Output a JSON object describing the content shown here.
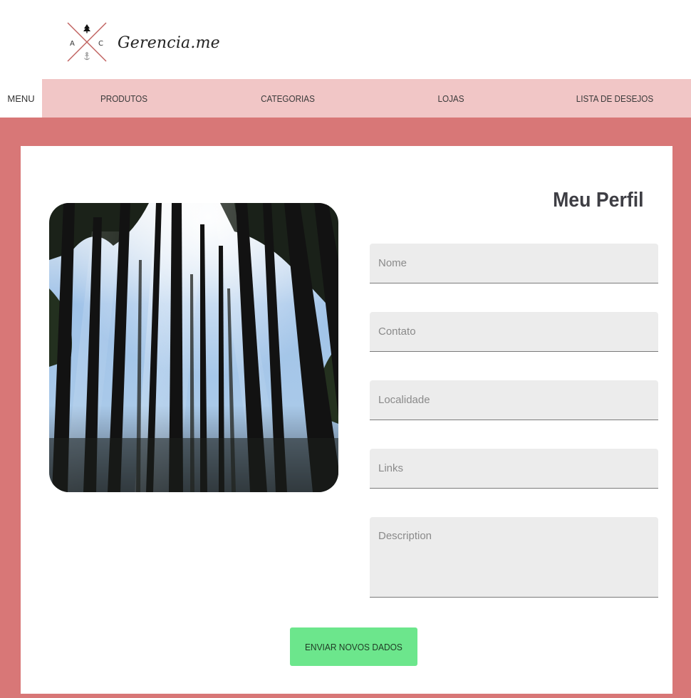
{
  "brand": {
    "name": "Gerencia.me",
    "logo_letters": [
      "A",
      "C"
    ]
  },
  "nav": {
    "menu_label": "MENU",
    "items": [
      {
        "label": "PRODUTOS"
      },
      {
        "label": "CATEGORIAS"
      },
      {
        "label": "LOJAS"
      },
      {
        "label": "LISTA DE DESEJOS"
      }
    ]
  },
  "profile": {
    "title": "Meu Perfil",
    "photo_icon": "forest-photo",
    "fields": {
      "nome": {
        "placeholder": "Nome",
        "value": ""
      },
      "contato": {
        "placeholder": "Contato",
        "value": ""
      },
      "localidade": {
        "placeholder": "Localidade",
        "value": ""
      },
      "links": {
        "placeholder": "Links",
        "value": ""
      },
      "description": {
        "placeholder": "Description",
        "value": ""
      }
    },
    "submit_label": "ENVIAR NOVOS DADOS"
  },
  "colors": {
    "nav_background": "#f1c6c6",
    "page_background": "#d87777",
    "submit_button": "#6ce68c",
    "logo_cross": "#c0605e"
  }
}
